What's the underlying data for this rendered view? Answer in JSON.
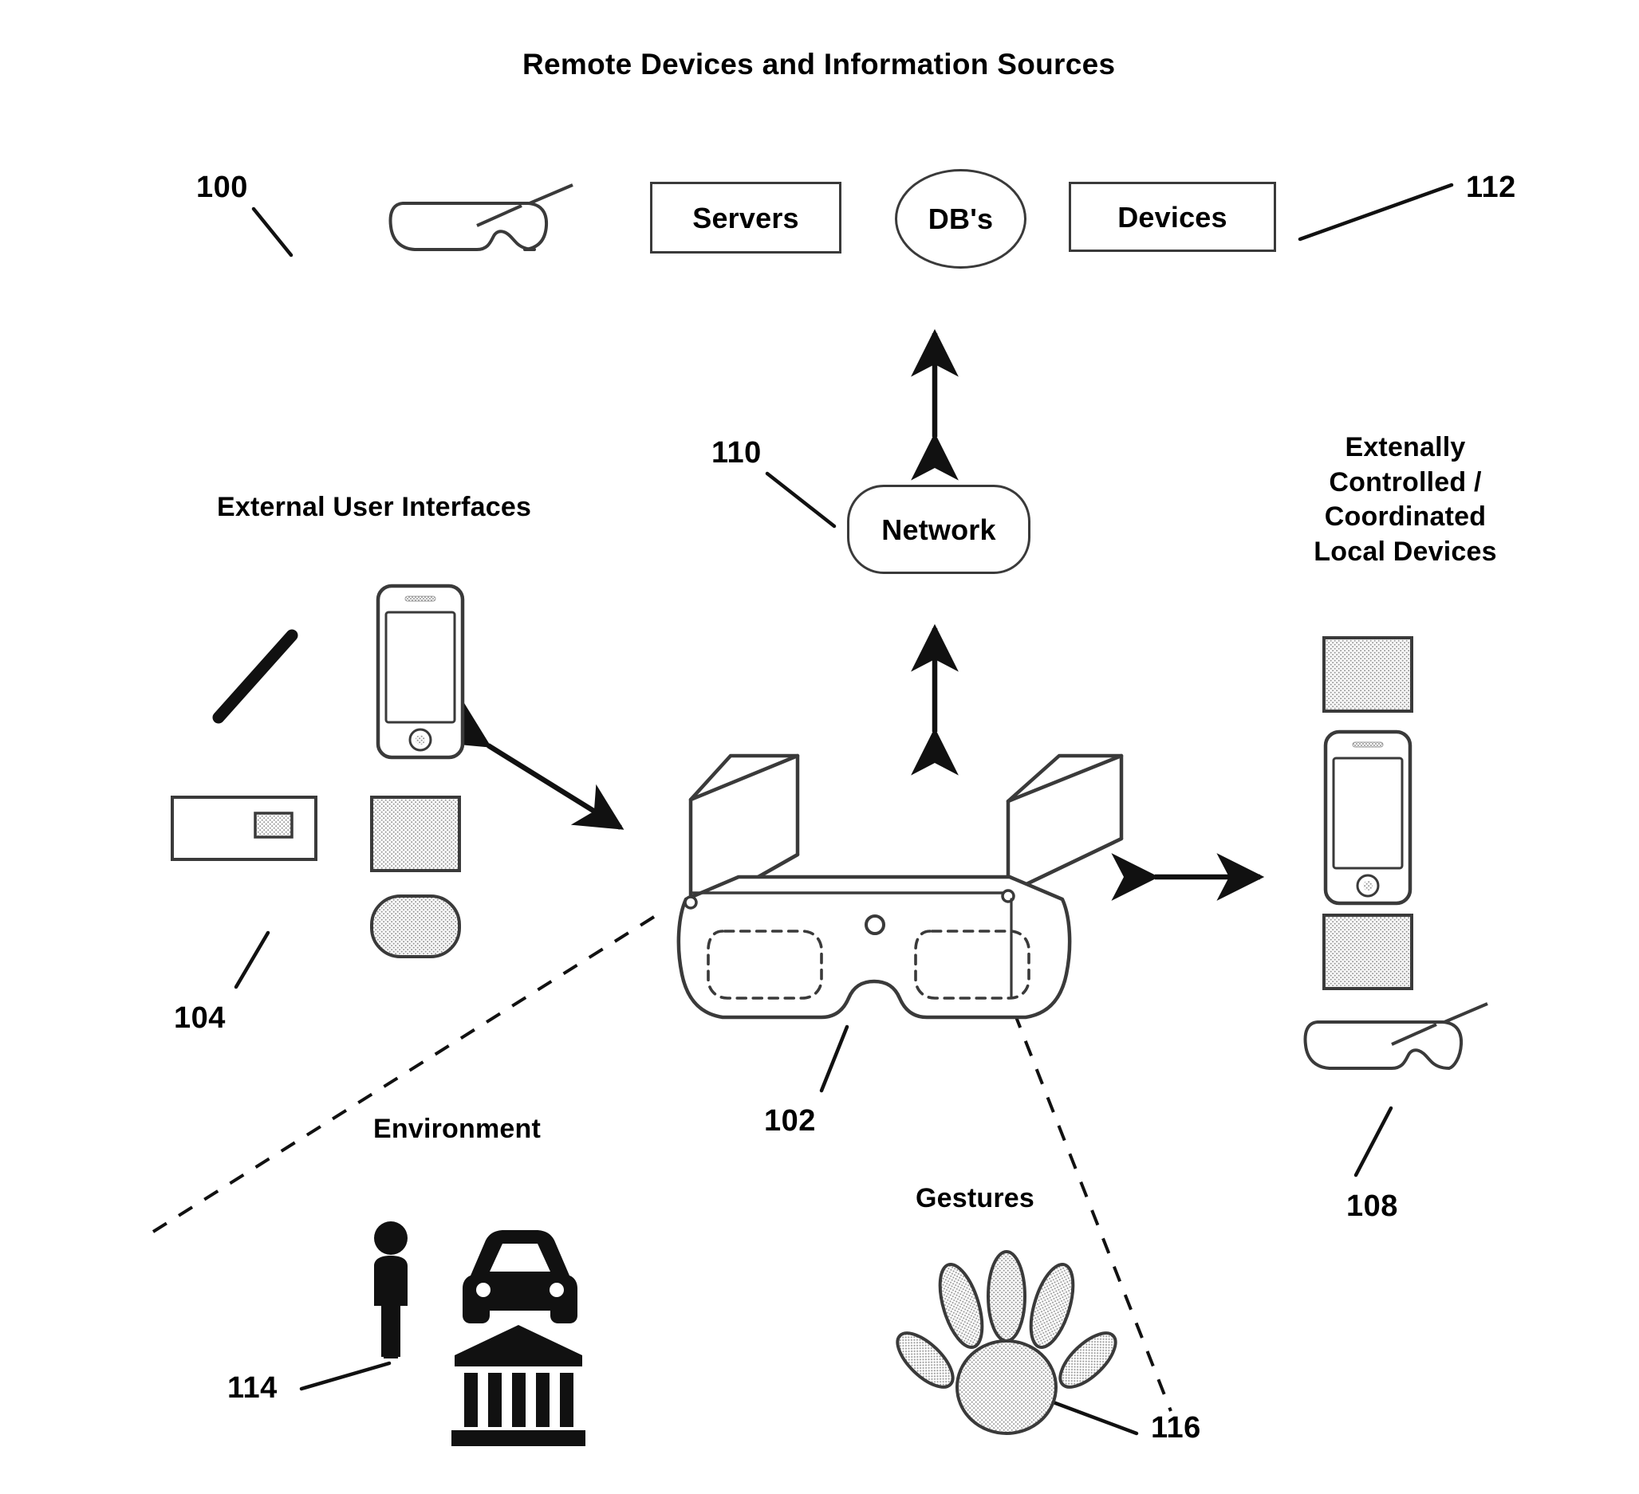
{
  "figure": {
    "title": "Remote Devices and Information Sources",
    "type": "patent-system-architecture-diagram"
  },
  "nodes": {
    "servers": "Servers",
    "dbs": "DB's",
    "devices": "Devices",
    "network": "Network"
  },
  "section_labels": {
    "external_user_interfaces": "External User Interfaces",
    "externally_controlled": "Extenally\nControlled /\nCoordinated\nLocal Devices",
    "environment": "Environment",
    "gestures": "Gestures"
  },
  "reference_numerals": {
    "n100": "100",
    "n102": "102",
    "n104": "104",
    "n108": "108",
    "n110": "110",
    "n112": "112",
    "n114": "114",
    "n116": "116"
  },
  "icons": {
    "goggles_top": "goggles-icon",
    "goggles_right": "goggles-icon",
    "stylus": "stylus-icon",
    "remote": "remote-control-icon",
    "phone_left": "smartphone-icon",
    "tablet_left": "tablet-icon",
    "puck_left": "rounded-device-icon",
    "tablet_right_top": "tablet-icon",
    "phone_right": "smartphone-icon",
    "tablet_right_bottom": "tablet-icon",
    "person": "person-icon",
    "car": "car-icon",
    "building": "bank-building-icon",
    "hand": "hand-gesture-icon",
    "eyewear": "smart-eyewear-icon"
  },
  "colors": {
    "stroke": "#3a3a3a",
    "ink": "#000000",
    "fill_texture": "#d9d9d9",
    "background": "#ffffff"
  }
}
